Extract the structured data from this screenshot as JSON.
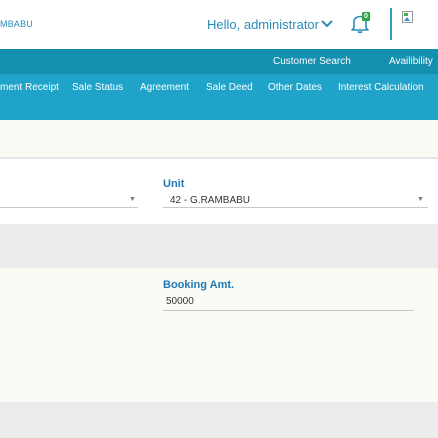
{
  "header": {
    "brand": "MBABU",
    "greeting": "Hello, administrator",
    "notification_count": "0",
    "icons": [
      "chevron-down-icon",
      "bell-icon",
      "broken-image-icon"
    ]
  },
  "nav_top": {
    "items": [
      "Customer Search",
      "Availibility"
    ]
  },
  "nav_main": {
    "items": [
      "ment Receipt",
      "Sale Status",
      "Agreement",
      "Sale Deed",
      "Other Dates",
      "Interest Calculation"
    ]
  },
  "form": {
    "unit_label": "Unit",
    "unit_value": "42 - G.RAMBABU",
    "booking_label": "Booking Amt.",
    "booking_value": "50000"
  },
  "colors": {
    "nav_dark": "#138fb0",
    "nav_light": "#1fa3c9",
    "label_blue": "#1f78b4",
    "badge_green": "#2ba84a"
  }
}
